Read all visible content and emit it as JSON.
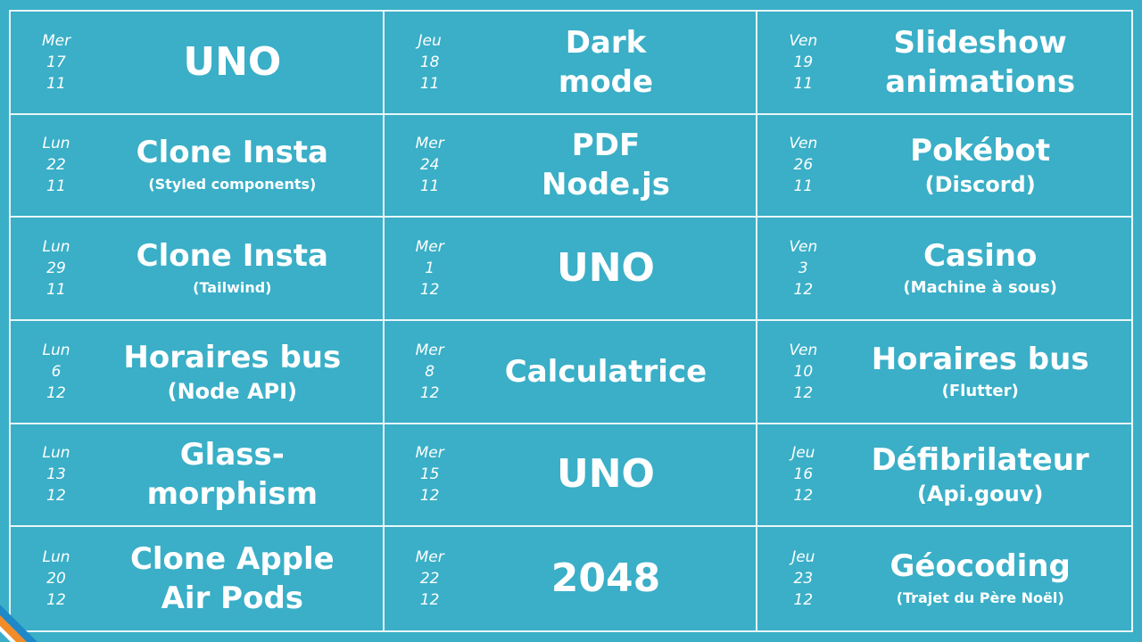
{
  "cells": [
    {
      "day": "Mer",
      "date": "17",
      "month": "11",
      "title": "UNO",
      "subtitle": ""
    },
    {
      "day": "Jeu",
      "date": "18",
      "month": "11",
      "title": "Dark\nmode",
      "subtitle": ""
    },
    {
      "day": "Ven",
      "date": "19",
      "month": "11",
      "title": "Slideshow\nanimations",
      "subtitle": ""
    },
    {
      "day": "Lun",
      "date": "22",
      "month": "11",
      "title": "Clone Insta",
      "subtitle": "(Styled components)"
    },
    {
      "day": "Mer",
      "date": "24",
      "month": "11",
      "title": "PDF\nNode.js",
      "subtitle": ""
    },
    {
      "day": "Ven",
      "date": "26",
      "month": "11",
      "title": "Pokébot",
      "subtitle": "(Discord)"
    },
    {
      "day": "Lun",
      "date": "29",
      "month": "11",
      "title": "Clone Insta",
      "subtitle": "(Tailwind)"
    },
    {
      "day": "Mer",
      "date": "1",
      "month": "12",
      "title": "UNO",
      "subtitle": ""
    },
    {
      "day": "Ven",
      "date": "3",
      "month": "12",
      "title": "Casino",
      "subtitle": "(Machine à sous)"
    },
    {
      "day": "Lun",
      "date": "6",
      "month": "12",
      "title": "Horaires bus",
      "subtitle": "(Node API)"
    },
    {
      "day": "Mer",
      "date": "8",
      "month": "12",
      "title": "Calculatrice",
      "subtitle": ""
    },
    {
      "day": "Ven",
      "date": "10",
      "month": "12",
      "title": "Horaires bus",
      "subtitle": "(Flutter)"
    },
    {
      "day": "Lun",
      "date": "13",
      "month": "12",
      "title": "Glass-\nmorphism",
      "subtitle": ""
    },
    {
      "day": "Mer",
      "date": "15",
      "month": "12",
      "title": "UNO",
      "subtitle": ""
    },
    {
      "day": "Jeu",
      "date": "16",
      "month": "12",
      "title": "Défibrilateur",
      "subtitle": "(Api.gouv)"
    },
    {
      "day": "Lun",
      "date": "20",
      "month": "12",
      "title": "Clone Apple\nAir Pods",
      "subtitle": ""
    },
    {
      "day": "Mer",
      "date": "22",
      "month": "12",
      "title": "2048",
      "subtitle": ""
    },
    {
      "day": "Jeu",
      "date": "23",
      "month": "12",
      "title": "Géocoding",
      "subtitle": "(Trajet du Père Noël)"
    }
  ],
  "colors": {
    "background": "#3AAFC7",
    "lines": "#E9F6F9",
    "accent_orange": "#F28C28",
    "accent_blue": "#1E88C8",
    "accent_white": "#FFFFFF"
  }
}
